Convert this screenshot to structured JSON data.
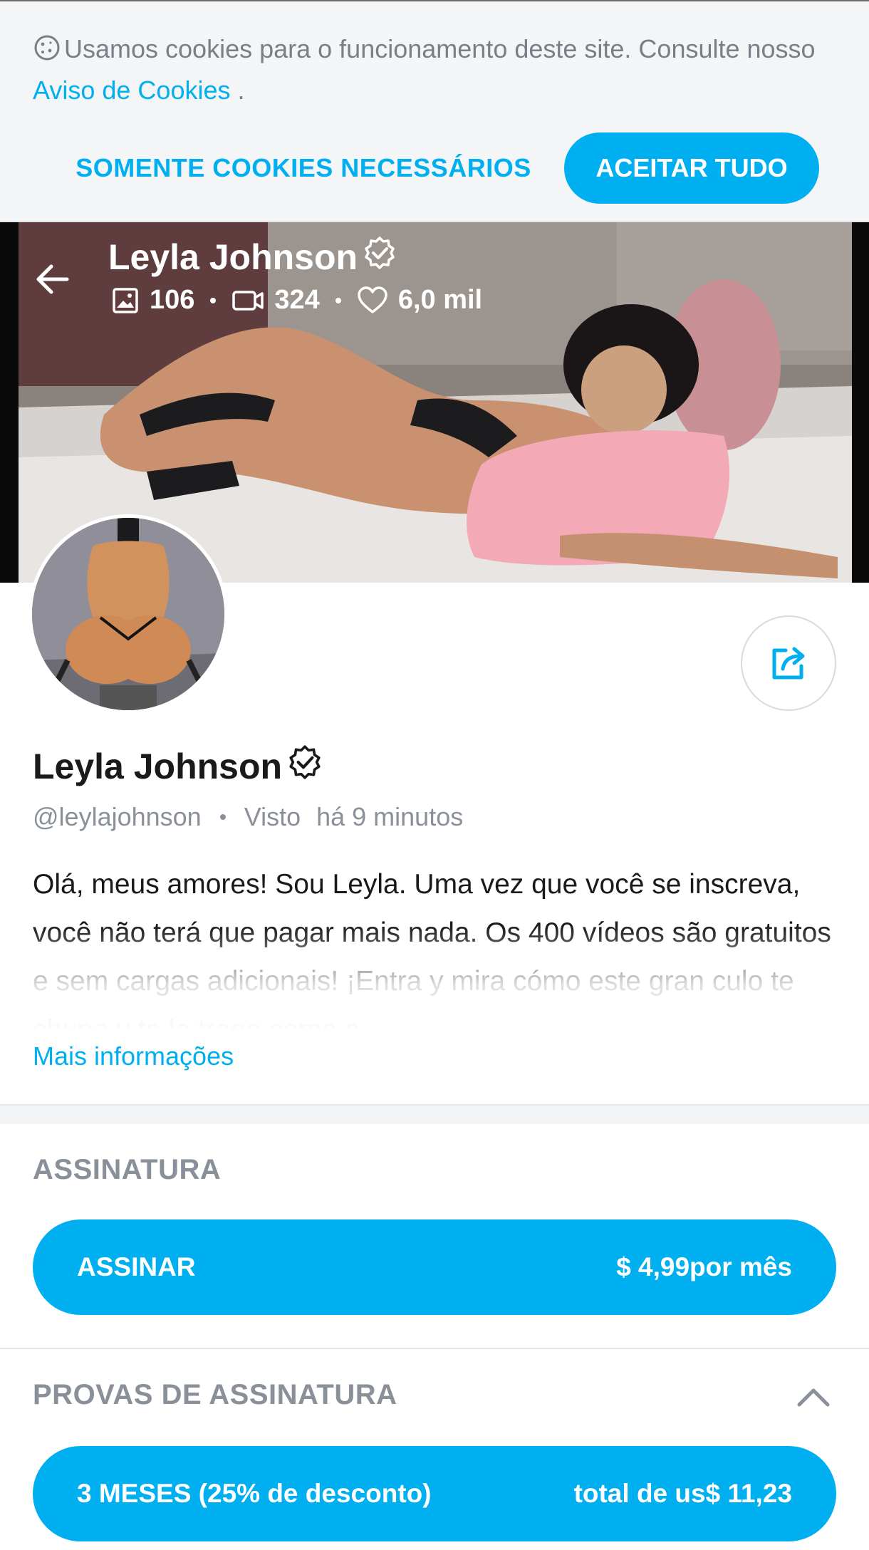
{
  "cookie_banner": {
    "text_prefix": "Usamos cookies para o funcionamento deste site. Consulte nosso",
    "link_label": "Aviso de Cookies",
    "text_suffix": ".",
    "necessary_label": "SOMENTE COOKIES NECESSÁRIOS",
    "accept_label": "ACEITAR TUDO",
    "icon": "cookie-icon"
  },
  "header": {
    "name": "Leyla Johnson",
    "photos_count": "106",
    "videos_count": "324",
    "likes_count": "6,0 mil",
    "icons": [
      "back-arrow-icon",
      "verified-badge-icon",
      "image-icon",
      "video-icon",
      "heart-icon"
    ]
  },
  "profile": {
    "name": "Leyla Johnson",
    "username": "@leylajohnson",
    "seen_label": "Visto",
    "seen_time": "há 9 minutos",
    "bio": "Olá, meus amores! Sou Leyla. Uma vez que você se ins­creva, você não terá que pagar mais nada. Os 400 ví­deos são gratuitos e sem cargas adicionais! ¡Entra y mira cómo este gran culo te chupa y te la traga como a",
    "more_info_label": "Mais informações",
    "share_icon": "share-icon"
  },
  "subscription": {
    "title": "ASSINATURA",
    "button_label": "ASSINAR",
    "price": "$ 4,99por mês"
  },
  "bundles": {
    "title": "PROVAS DE ASSINATURA",
    "items": [
      {
        "label": "3 MESES (25% de desconto)",
        "total": "total de us$ 11,23"
      }
    ],
    "toggle_icon": "chevron-up-icon"
  },
  "colors": {
    "accent": "#00aff0",
    "muted_text": "#8a9099",
    "banner_bg": "#f4f5f7"
  }
}
